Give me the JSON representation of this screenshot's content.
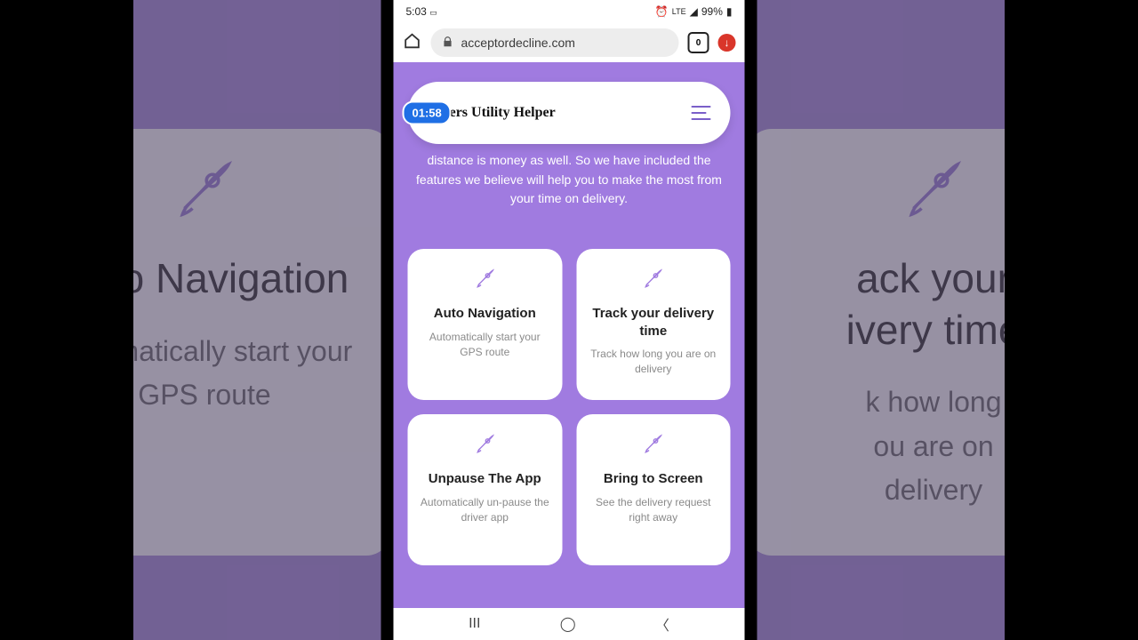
{
  "status": {
    "time": "5:03",
    "lte": "LTE",
    "battery": "99%",
    "alarm_icon": "⏰",
    "signal_icon": "📶",
    "battery_icon": "▮"
  },
  "browser": {
    "url": "acceptordecline.com",
    "tabs": "0"
  },
  "nav": {
    "brand": "Drivers Utility Helper",
    "timer": "01:58"
  },
  "intro": "distance is money as well. So we have included the features we believe will help you to make the most from your time on delivery.",
  "cards": [
    {
      "title": "Auto Navigation",
      "desc": "Automatically start your GPS route"
    },
    {
      "title": "Track your delivery time",
      "desc": "Track how long you are on delivery"
    },
    {
      "title": "Unpause The App",
      "desc": "Automatically un-pause the driver app"
    },
    {
      "title": "Bring to Screen",
      "desc": "See the delivery request right away"
    }
  ],
  "bg": {
    "left": {
      "title": "Auto Navigation",
      "desc": "Automatically start your GPS route"
    },
    "right": {
      "title": "Track your delivery time",
      "desc": "Track how long you are on delivery"
    }
  },
  "anav": {
    "recent": "III",
    "home": "◯",
    "back": "〈"
  }
}
